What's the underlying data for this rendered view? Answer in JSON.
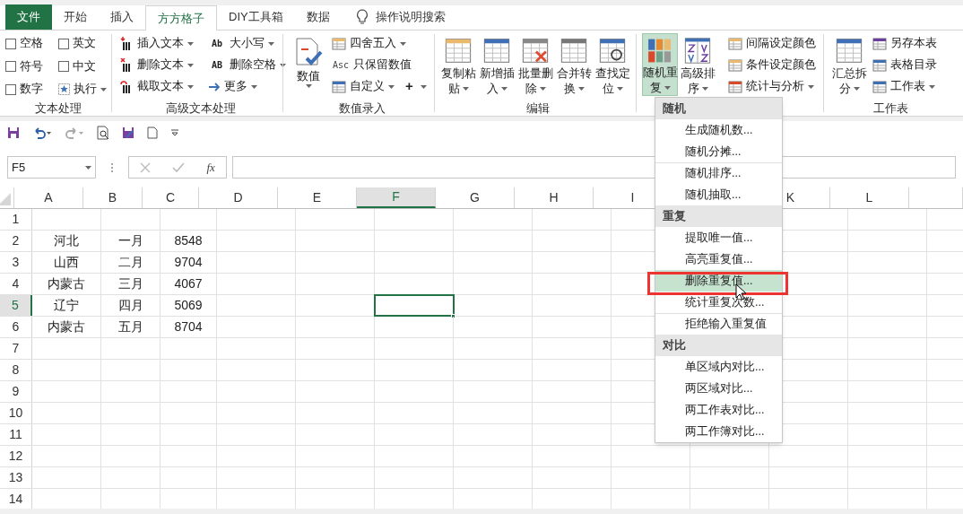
{
  "tabs": [
    {
      "label": "文件",
      "kind": "file",
      "selected": false
    },
    {
      "label": "开始",
      "kind": "tab",
      "selected": false
    },
    {
      "label": "插入",
      "kind": "tab",
      "selected": false
    },
    {
      "label": "方方格子",
      "kind": "tab",
      "selected": true
    },
    {
      "label": "DIY工具箱",
      "kind": "tab",
      "selected": false
    },
    {
      "label": "数据",
      "kind": "tab",
      "selected": false
    }
  ],
  "tell_me": {
    "placeholder": "操作说明搜索"
  },
  "ribbon": {
    "text_group": {
      "label": "文本处理",
      "checkboxes": [
        {
          "label": "空格",
          "checked": false
        },
        {
          "label": "英文",
          "checked": false
        },
        {
          "label": "符号",
          "checked": false
        },
        {
          "label": "中文",
          "checked": false
        },
        {
          "label": "数字",
          "checked": false
        }
      ],
      "run": {
        "label": "执行"
      }
    },
    "advanced_text": {
      "label": "高级文本处理",
      "items": [
        {
          "label": "插入文本"
        },
        {
          "label": "删除文本"
        },
        {
          "label": "截取文本"
        }
      ],
      "items2": [
        {
          "label": "大小写",
          "badge": "Ab"
        },
        {
          "label": "删除空格",
          "badge": "AB"
        },
        {
          "label": "更多"
        }
      ]
    },
    "number_entry": {
      "label": "数值录入",
      "big": {
        "label": "数值"
      },
      "items": [
        {
          "label": "四舍五入"
        },
        {
          "label": "只保留数值",
          "badge": "Asc"
        },
        {
          "label": "自定义"
        }
      ],
      "plus": "+"
    },
    "edit": {
      "label": "编辑",
      "buttons": [
        {
          "lines": [
            "复制粘",
            "贴"
          ]
        },
        {
          "lines": [
            "新增插",
            "入"
          ]
        },
        {
          "lines": [
            "批量删",
            "除"
          ]
        },
        {
          "lines": [
            "合并转",
            "换"
          ]
        },
        {
          "lines": [
            "查找定",
            "位"
          ]
        }
      ]
    },
    "random": {
      "buttons": [
        {
          "lines": [
            "随机重",
            "复"
          ],
          "selected": true
        },
        {
          "lines": [
            "高级排",
            "序"
          ],
          "selected": false
        }
      ],
      "items": [
        {
          "label": "间隔设定颜色"
        },
        {
          "label": "条件设定颜色"
        },
        {
          "label": "统计与分析"
        }
      ]
    },
    "sheet": {
      "label": "工作表",
      "big": {
        "lines": [
          "汇总拆",
          "分"
        ]
      },
      "items": [
        {
          "label": "另存本表"
        },
        {
          "label": "表格目录"
        },
        {
          "label": "工作表"
        }
      ]
    }
  },
  "name_box": {
    "value": "F5"
  },
  "formula_bar": {
    "fx": "fx"
  },
  "columns": [
    {
      "label": "A",
      "selected": false
    },
    {
      "label": "B",
      "selected": false
    },
    {
      "label": "C",
      "selected": false
    },
    {
      "label": "D",
      "selected": false
    },
    {
      "label": "E",
      "selected": false
    },
    {
      "label": "F",
      "selected": true
    },
    {
      "label": "G",
      "selected": false
    },
    {
      "label": "H",
      "selected": false
    },
    {
      "label": "I",
      "selected": false
    },
    {
      "label": "K",
      "selected": false
    },
    {
      "label": "L",
      "selected": false
    }
  ],
  "rows": [
    {
      "header": "1",
      "selected": false,
      "cells": []
    },
    {
      "header": "2",
      "selected": false,
      "cells": [
        "河北",
        "一月",
        "8548"
      ]
    },
    {
      "header": "3",
      "selected": false,
      "cells": [
        "山西",
        "二月",
        "9704"
      ]
    },
    {
      "header": "4",
      "selected": false,
      "cells": [
        "内蒙古",
        "三月",
        "4067"
      ]
    },
    {
      "header": "5",
      "selected": true,
      "cells": [
        "辽宁",
        "四月",
        "5069"
      ]
    },
    {
      "header": "6",
      "selected": false,
      "cells": [
        "内蒙古",
        "五月",
        "8704"
      ]
    },
    {
      "header": "7",
      "selected": false,
      "cells": []
    },
    {
      "header": "8",
      "selected": false,
      "cells": []
    },
    {
      "header": "9",
      "selected": false,
      "cells": []
    },
    {
      "header": "10",
      "selected": false,
      "cells": []
    },
    {
      "header": "11",
      "selected": false,
      "cells": []
    },
    {
      "header": "12",
      "selected": false,
      "cells": []
    },
    {
      "header": "13",
      "selected": false,
      "cells": []
    },
    {
      "header": "14",
      "selected": false,
      "cells": []
    }
  ],
  "menu": [
    {
      "kind": "header",
      "label": "随机"
    },
    {
      "kind": "item",
      "label": "生成随机数...",
      "selected": false,
      "divider_above": false
    },
    {
      "kind": "item",
      "label": "随机分摊...",
      "selected": false,
      "divider_above": false
    },
    {
      "kind": "item",
      "label": "随机排序...",
      "selected": false,
      "divider_above": true
    },
    {
      "kind": "item",
      "label": "随机抽取...",
      "selected": false,
      "divider_above": false
    },
    {
      "kind": "header",
      "label": "重复"
    },
    {
      "kind": "item",
      "label": "提取唯一值...",
      "selected": false,
      "divider_above": false
    },
    {
      "kind": "item",
      "label": "高亮重复值...",
      "selected": false,
      "divider_above": false
    },
    {
      "kind": "item",
      "label": "删除重复值...",
      "selected": true,
      "divider_above": false
    },
    {
      "kind": "item",
      "label": "统计重复次数...",
      "selected": false,
      "divider_above": false
    },
    {
      "kind": "item",
      "label": "拒绝输入重复值",
      "selected": false,
      "divider_above": true
    },
    {
      "kind": "header",
      "label": "对比"
    },
    {
      "kind": "item",
      "label": "单区域内对比...",
      "selected": false,
      "divider_above": false
    },
    {
      "kind": "item",
      "label": "两区域对比...",
      "selected": false,
      "divider_above": false
    },
    {
      "kind": "item",
      "label": "两工作表对比...",
      "selected": false,
      "divider_above": false
    },
    {
      "kind": "item",
      "label": "两工作簿对比...",
      "selected": false,
      "divider_above": false
    }
  ]
}
